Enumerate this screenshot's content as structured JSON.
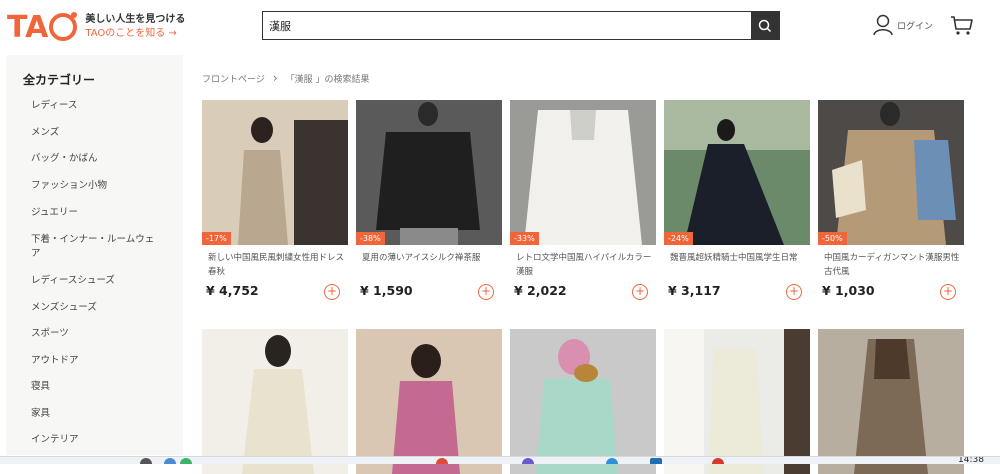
{
  "header": {
    "logo_text": "TA",
    "logo_tagline": "美しい人生を見つける",
    "logo_link": "TAOのことを知る →",
    "search_value": "漢服",
    "login_label": "ログイン"
  },
  "sidebar": {
    "title": "全カテゴリー",
    "items": [
      "レディース",
      "メンズ",
      "バッグ・かばん",
      "ファッション小物",
      "ジュエリー",
      "下着・インナー・ルームウェア",
      "レディースシューズ",
      "メンズシューズ",
      "スポーツ",
      "アウトドア",
      "寝具",
      "家具",
      "インテリア"
    ]
  },
  "breadcrumb": {
    "home": "フロントページ",
    "separator": "›",
    "current": "「漢服 」の検索結果"
  },
  "products": [
    {
      "discount": "-17%",
      "title": "新しい中国風民風刺繍女性用ドレス春秋",
      "price": "¥ 4,752",
      "colors": [
        "#d9ccb8",
        "#b9a88f",
        "#3a3330"
      ]
    },
    {
      "discount": "-38%",
      "title": "夏用の薄いアイスシルク禅茶服",
      "price": "¥ 1,590",
      "colors": [
        "#5a5a5a",
        "#1f1f1f",
        "#8a8a8a"
      ]
    },
    {
      "discount": "-33%",
      "title": "レトロ文学中国風ハイパイルカラー漢服",
      "price": "¥ 2,022",
      "colors": [
        "#9a9a96",
        "#f1f0ec",
        "#cfcfca"
      ]
    },
    {
      "discount": "-24%",
      "title": "魏晋風超妖精騎士中国風学生日常",
      "price": "¥ 3,117",
      "colors": [
        "#6b8a6a",
        "#1b1f2a",
        "#a8b9a0"
      ]
    },
    {
      "discount": "-50%",
      "title": "中国風カーディガンマント漢服男性古代風",
      "price": "¥ 1,030",
      "colors": [
        "#4e4a47",
        "#b59a78",
        "#6b8fb5"
      ]
    },
    {
      "colors": [
        "#f2efe8",
        "#e9e2cf",
        "#2a2420"
      ]
    },
    {
      "colors": [
        "#d9c7b3",
        "#c46a90",
        "#2b1f1c"
      ]
    },
    {
      "colors": [
        "#9cc7c9",
        "#a8d8c8",
        "#d88fb0"
      ]
    },
    {
      "colors": [
        "#ebebe8",
        "#ecead9",
        "#4a3c30"
      ]
    },
    {
      "colors": [
        "#7d6a56",
        "#4e3a2a",
        "#b8aea0"
      ]
    }
  ],
  "taskbar": {
    "time": "14:38"
  }
}
